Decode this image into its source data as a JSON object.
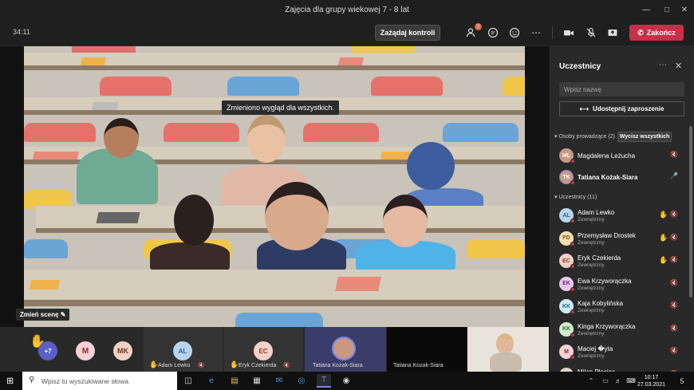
{
  "window": {
    "title": "Zajęcia dla grupy wiekowej 7 - 8 lat",
    "controls": [
      "minimize-icon",
      "maximize-icon",
      "close-icon"
    ]
  },
  "toolbar": {
    "timer": "34:11",
    "control_button": "Zażądaj kontroli",
    "participants_badge": "2",
    "end_button": "Zakończ",
    "icons": [
      "participants-icon",
      "chat-icon",
      "reactions-icon",
      "more-icon",
      "camera-icon",
      "mic-off-icon",
      "share-icon"
    ]
  },
  "stage": {
    "notice": "Zmieniono wygląd dla wszystkich.",
    "scene_button": "Zmień scenę"
  },
  "strip": {
    "hands_count": "+7",
    "tiles": [
      {
        "initials": "M",
        "name": ""
      },
      {
        "initials": "MK",
        "name": ""
      },
      {
        "initials": "AL",
        "name": "Adam Lewko"
      },
      {
        "initials": "EC",
        "name": "Eryk Czekierda"
      },
      {
        "initials": "",
        "name": "Tatiana Kożak-Siara"
      },
      {
        "initials": "",
        "name": "Tatiana Kozak-Siara"
      }
    ]
  },
  "panel": {
    "title": "Uczestnicy",
    "search_placeholder": "Wpisz nazwę",
    "share_label": "Udostępnij zaproszenie",
    "presenters_heading": "Osoby prowadzące (2)",
    "clear_all": "Wycisz wszystkich",
    "participants_heading": "Uczestnicy (11)",
    "presenters": [
      {
        "name": "Magdalena Leżucha",
        "initials": "ML",
        "bold": false
      },
      {
        "name": "Tatiana Kożak-Siara",
        "initials": "TK",
        "bold": true
      }
    ],
    "participants": [
      {
        "initials": "AL",
        "name": "Adam Lewko",
        "role": "Zewnętrzny",
        "hand": true,
        "color": "#b7d4ee",
        "text": "#2e5f8a"
      },
      {
        "initials": "PD",
        "name": "Przemysław Drostek",
        "role": "Zewnętrzny",
        "hand": true,
        "color": "#f3dfb4",
        "text": "#8a5a1c"
      },
      {
        "initials": "EC",
        "name": "Eryk Czekierda",
        "role": "Zewnętrzny",
        "hand": true,
        "color": "#f5d0c8",
        "text": "#8a3a2a"
      },
      {
        "initials": "EK",
        "name": "Ewa Krzyworączka",
        "role": "Zewnętrzny",
        "hand": false,
        "color": "#e8c9ee",
        "text": "#6a2a7a"
      },
      {
        "initials": "KK",
        "name": "Kaja Kobylińska",
        "role": "Zewnętrzny",
        "hand": false,
        "color": "#cdeaf2",
        "text": "#2a6a7a"
      },
      {
        "initials": "KK",
        "name": "Kinga Krzyworączka",
        "role": "Zewnętrzny",
        "hand": false,
        "color": "#d4ecd0",
        "text": "#2e6a2a"
      },
      {
        "initials": "M",
        "name": "Maciej �yta",
        "role": "Zewnętrzny",
        "hand": false,
        "color": "#f5d0d6",
        "text": "#8a2a3a"
      },
      {
        "initials": "MP",
        "name": "Milan Płocica",
        "role": "",
        "hand": false,
        "color": "#e0d4c8",
        "text": "#6a4a2a"
      }
    ]
  },
  "taskbar": {
    "search_placeholder": "Wpisz tu wyszukiwane słowa",
    "time": "10:17",
    "date": "27.03.2021",
    "notifications": "5"
  }
}
